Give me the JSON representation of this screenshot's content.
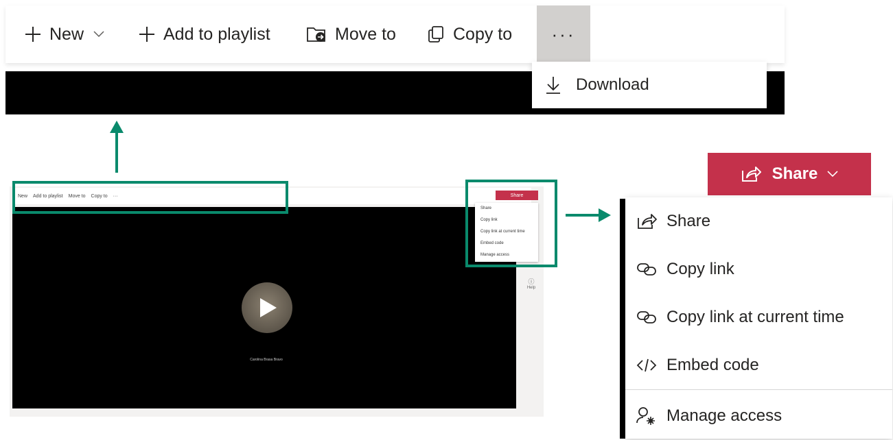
{
  "toolbar": {
    "new_label": "New",
    "add_playlist_label": "Add to playlist",
    "move_label": "Move to",
    "copy_label": "Copy to",
    "more_label": "···"
  },
  "more_menu": {
    "download_label": "Download"
  },
  "mini_screenshot": {
    "toolbar_new": "New",
    "toolbar_add": "Add to playlist",
    "toolbar_move": "Move to",
    "toolbar_copy": "Copy to",
    "share_label": "Share",
    "menu": [
      "Share",
      "Copy link",
      "Copy link at current time",
      "Embed code",
      "Manage access"
    ],
    "video_caption": "Carolina Brasa Bravo",
    "help_label": "Help"
  },
  "share": {
    "button_label": "Share",
    "menu": {
      "share": "Share",
      "copy_link": "Copy link",
      "copy_link_time": "Copy link at current time",
      "embed_code": "Embed code",
      "manage_access": "Manage access"
    }
  },
  "colors": {
    "accent_red": "#c4314b",
    "highlight_green": "#0a8a6c"
  }
}
